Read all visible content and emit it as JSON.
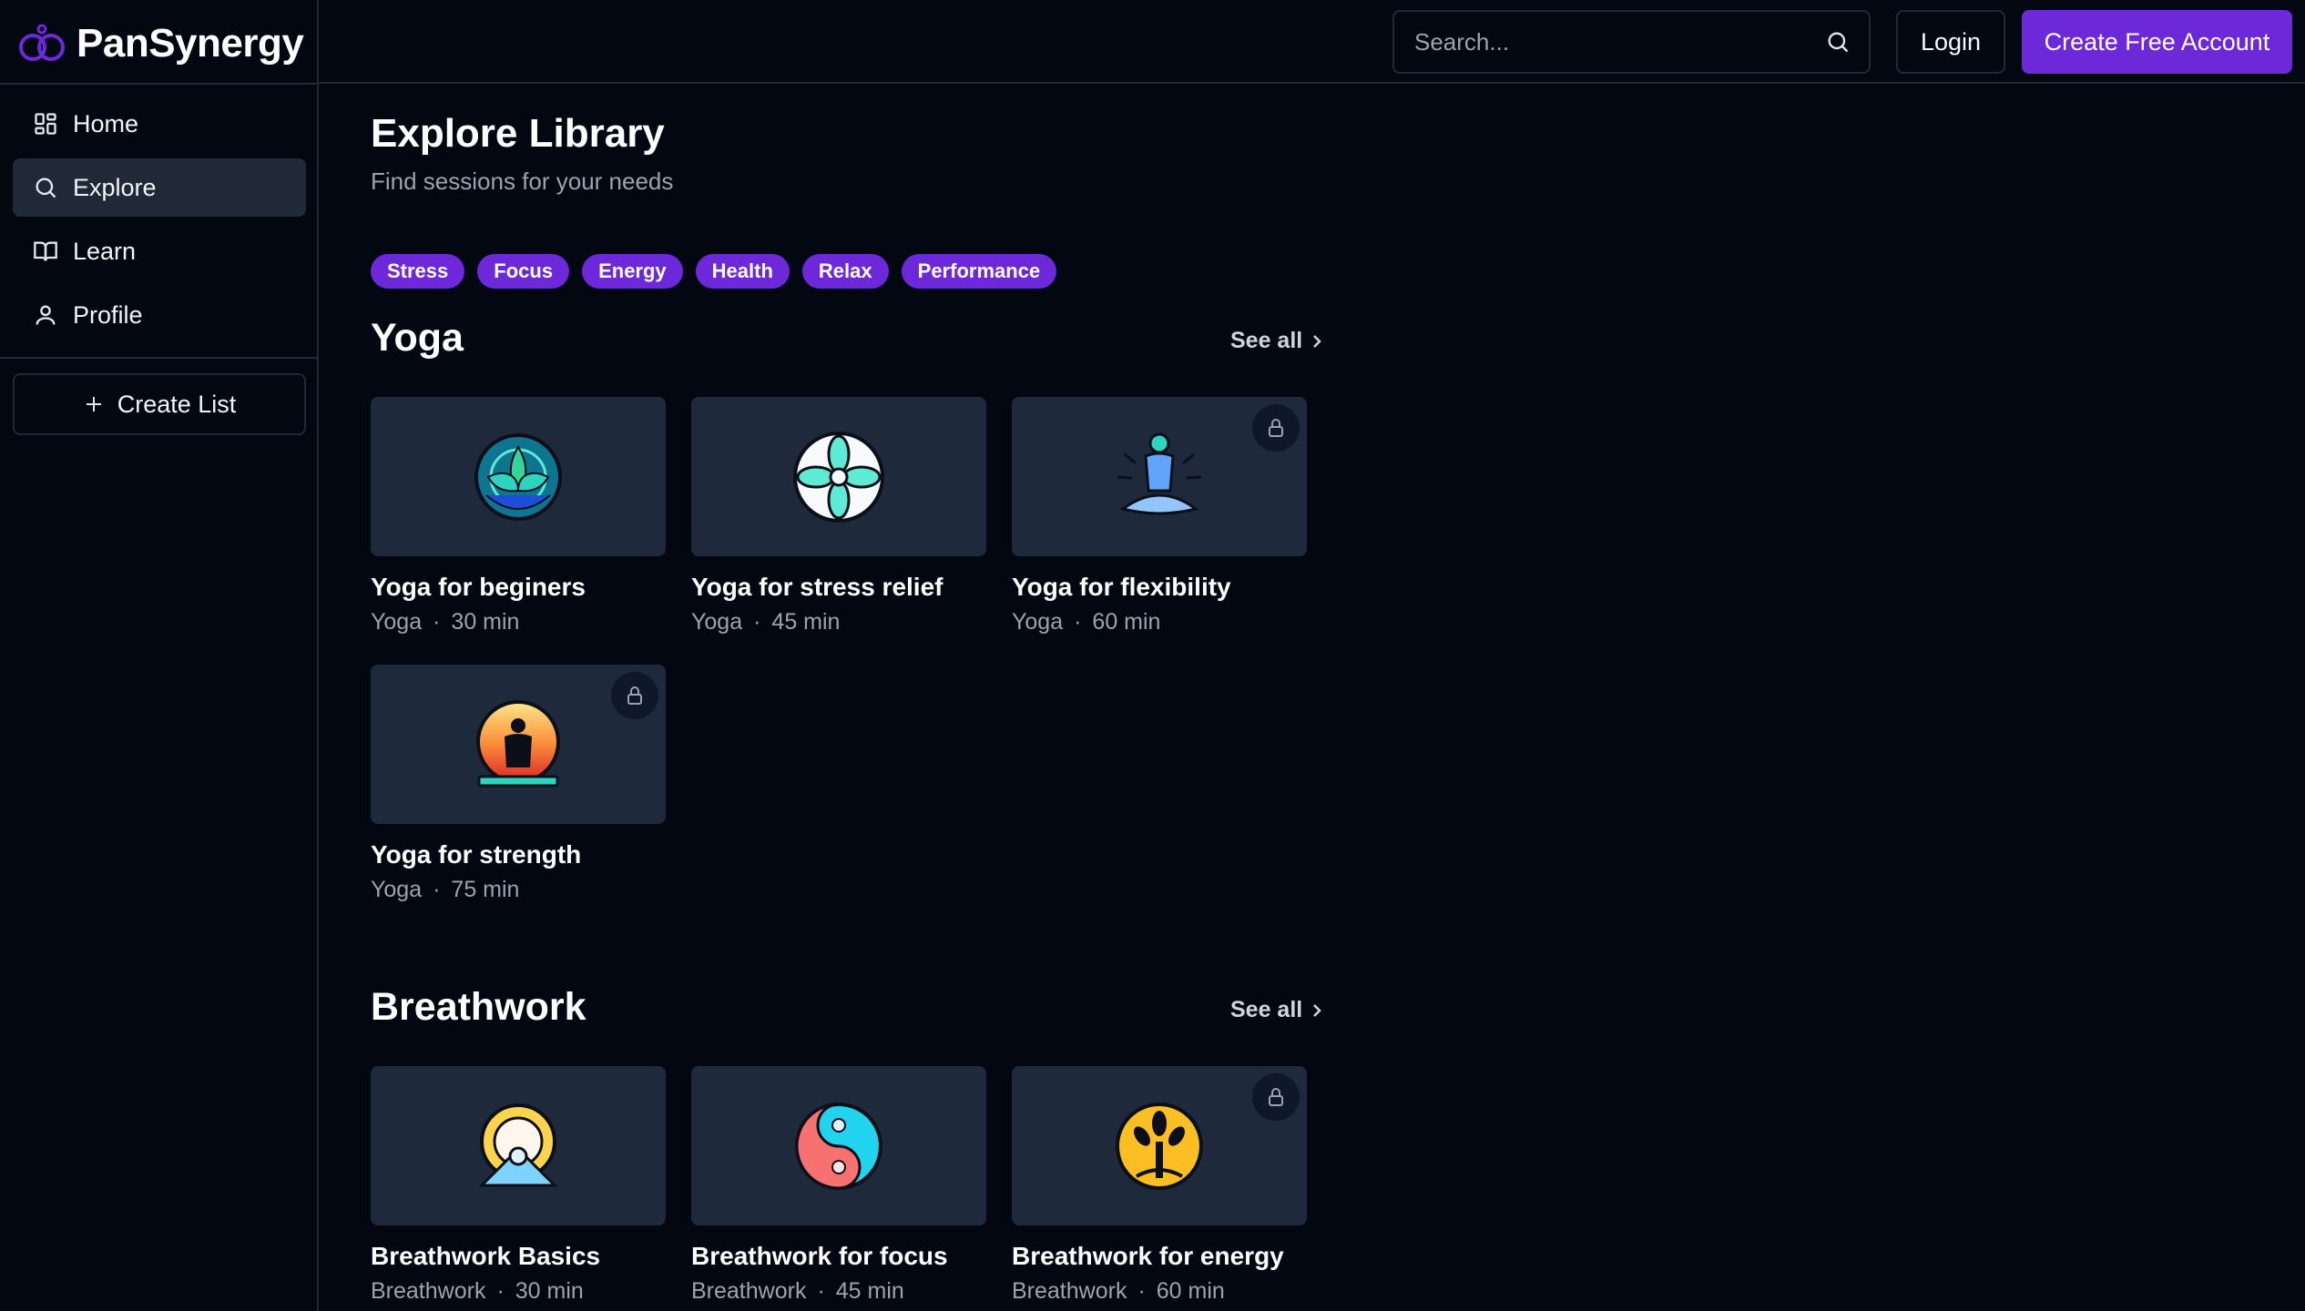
{
  "app": {
    "name": "PanSynergy"
  },
  "sidebar": {
    "items": [
      {
        "label": "Home",
        "icon": "grid-icon",
        "active": false
      },
      {
        "label": "Explore",
        "icon": "search-icon",
        "active": true
      },
      {
        "label": "Learn",
        "icon": "book-icon",
        "active": false
      },
      {
        "label": "Profile",
        "icon": "user-icon",
        "active": false
      }
    ],
    "create_list_label": "Create List"
  },
  "header": {
    "search_placeholder": "Search...",
    "login_label": "Login",
    "create_account_label": "Create Free Account"
  },
  "main": {
    "title": "Explore Library",
    "subtitle": "Find sessions for your needs",
    "tags": [
      "Stress",
      "Focus",
      "Energy",
      "Health",
      "Relax",
      "Performance"
    ],
    "sections": [
      {
        "title": "Yoga",
        "see_all_label": "See all",
        "cards": [
          {
            "title": "Yoga for beginers",
            "category": "Yoga",
            "duration": "30 min",
            "locked": false,
            "icon": "mandala-lotus-icon"
          },
          {
            "title": "Yoga for stress relief",
            "category": "Yoga",
            "duration": "45 min",
            "locked": false,
            "icon": "lotus-flower-icon"
          },
          {
            "title": "Yoga for flexibility",
            "category": "Yoga",
            "duration": "60 min",
            "locked": true,
            "icon": "meditating-figure-icon"
          },
          {
            "title": "Yoga for strength",
            "category": "Yoga",
            "duration": "75 min",
            "locked": true,
            "icon": "sunset-meditation-icon"
          }
        ]
      },
      {
        "title": "Breathwork",
        "see_all_label": "See all",
        "cards": [
          {
            "title": "Breathwork Basics",
            "category": "Breathwork",
            "duration": "30 min",
            "locked": false,
            "icon": "sunrise-breath-icon"
          },
          {
            "title": "Breathwork for focus",
            "category": "Breathwork",
            "duration": "45 min",
            "locked": false,
            "icon": "yin-yang-icon"
          },
          {
            "title": "Breathwork for energy",
            "category": "Breathwork",
            "duration": "60 min",
            "locked": true,
            "icon": "tree-of-life-icon"
          }
        ]
      }
    ]
  },
  "colors": {
    "background": "#030712",
    "accent": "#6d28d9",
    "card": "#1e293b",
    "border": "#1f2937",
    "muted_text": "#9ca3af"
  }
}
